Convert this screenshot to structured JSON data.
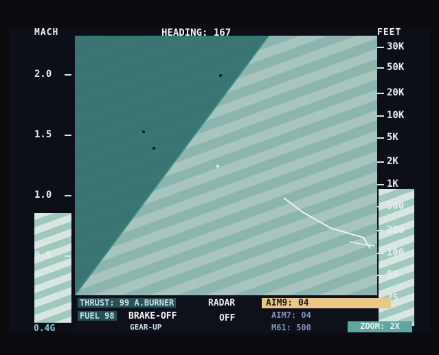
{
  "header": {
    "mach_label": "MACH",
    "heading_label": "HEADING: 167",
    "feet_label": "FEET"
  },
  "mach_scale": {
    "ticks": [
      "2.0",
      "1.5",
      "1.0",
      "0.5"
    ],
    "readout": "0.4G"
  },
  "feet_scale": {
    "ticks": [
      "30K",
      "50K",
      "20K",
      "10K",
      "5K",
      "2K",
      "1K",
      "500",
      "200",
      "100",
      "50",
      "25"
    ]
  },
  "hud": {
    "thrust": "THRUST: 99 A.BURNER",
    "fuel": "FUEL 98",
    "brake": "BRAKE-OFF",
    "gear": "GEAR-UP",
    "radar_label": "RADAR",
    "radar_state": "OFF",
    "weapon1": "AIM9: 04",
    "weapon2": "AIM7: 04",
    "weapon3": "M61: 500",
    "zoom": "ZOOM: 2X"
  },
  "colors": {
    "sky": "#2d6b6a",
    "ground_a": "#a7c4be",
    "ground_b": "#8bb5ad",
    "text": "#e9eef1",
    "accent": "#e7c887"
  }
}
